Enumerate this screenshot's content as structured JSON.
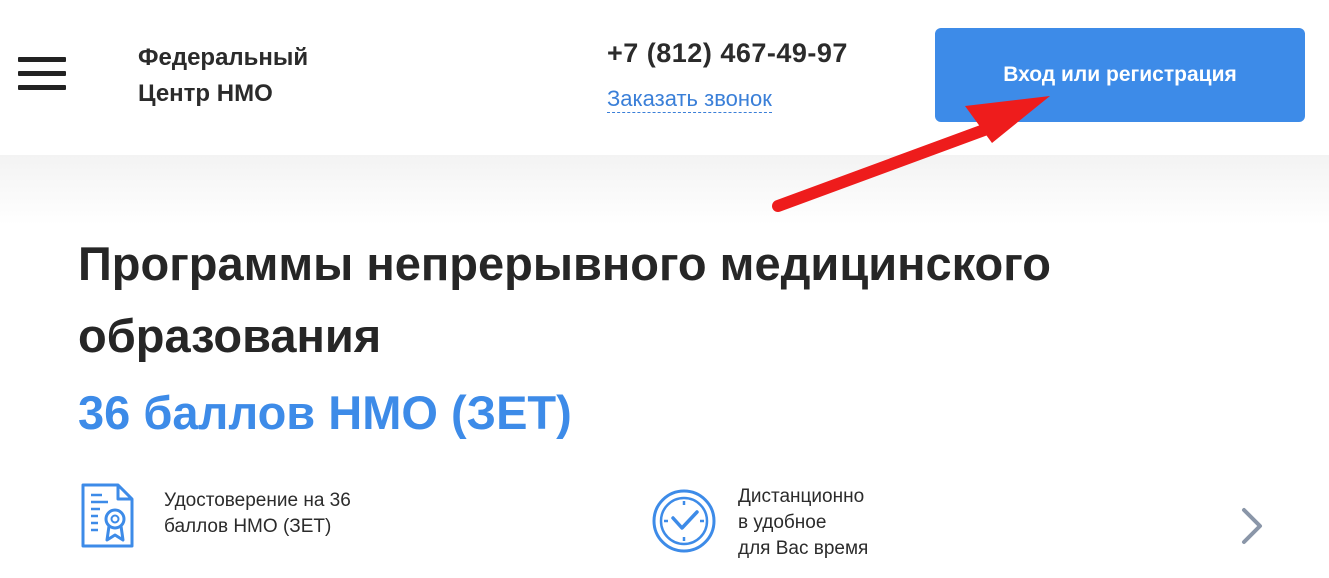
{
  "header": {
    "logo_line1": "Федеральный",
    "logo_line2": "Центр НМО",
    "phone": "+7 (812) 467-49-97",
    "callback_link": "Заказать звонок",
    "login_button": "Вход или регистрация"
  },
  "hero": {
    "title": "Программы непрерывного медицинского образования",
    "subtitle": "36 баллов НМО (ЗЕТ)"
  },
  "features": [
    {
      "icon": "certificate-icon",
      "line1": "Удостоверение на 36",
      "line2": "баллов НМО (ЗЕТ)"
    },
    {
      "icon": "clock-icon",
      "line1": "Дистанционно",
      "line2": "в удобное",
      "line3": "для Вас время"
    }
  ],
  "colors": {
    "accent": "#3d8be8",
    "arrow": "#ee1c1c",
    "text": "#262626"
  }
}
